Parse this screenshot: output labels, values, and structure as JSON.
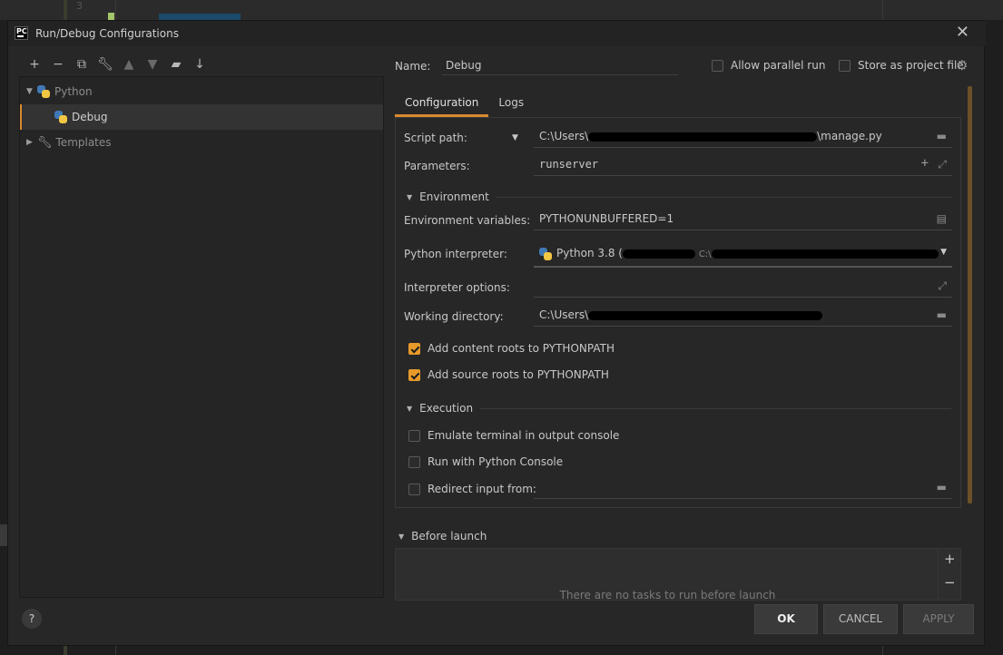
{
  "dialog": {
    "title": "Run/Debug Configurations",
    "app_icon_text": "PC"
  },
  "background": {
    "line_number": "3"
  },
  "toolbar": {
    "icons": [
      "plus-icon",
      "minus-icon",
      "copy-icon",
      "wrench-icon",
      "arrow-up-icon",
      "arrow-down-icon",
      "new-folder-icon",
      "sort-icon"
    ]
  },
  "tree": {
    "python_label": "Python",
    "debug_label": "Debug",
    "templates_label": "Templates"
  },
  "name": {
    "label": "Name:",
    "value": "Debug",
    "allow_parallel": "Allow parallel run",
    "store_project": "Store as project file"
  },
  "tabs": [
    "Configuration",
    "Logs"
  ],
  "config": {
    "script_path_label": "Script path:",
    "script_path_prefix": "C:\\Users\\",
    "script_path_suffix": "\\manage.py",
    "parameters_label": "Parameters:",
    "parameters_value": "runserver",
    "environment_section": "Environment",
    "env_vars_label": "Environment variables:",
    "env_vars_value": "PYTHONUNBUFFERED=1",
    "interpreter_label": "Python interpreter:",
    "interpreter_value": "Python 3.8 (",
    "interpreter_path_prefix": "C:\\",
    "interpreter_options_label": "Interpreter options:",
    "working_dir_label": "Working directory:",
    "working_dir_prefix": "C:\\Users\\",
    "add_content_roots": "Add content roots to PYTHONPATH",
    "add_source_roots": "Add source roots to PYTHONPATH",
    "execution_section": "Execution",
    "emulate_terminal": "Emulate terminal in output console",
    "run_python_console": "Run with Python Console",
    "redirect_input": "Redirect input from:"
  },
  "before_launch": {
    "label": "Before launch",
    "empty_text": "There are no tasks to run before launch"
  },
  "buttons": {
    "help": "?",
    "ok": "OK",
    "cancel": "CANCEL",
    "apply": "APPLY"
  },
  "colors": {
    "accent": "#d8892f",
    "checkbox_on": "#e79a2a",
    "python_blue": "#3f79b6",
    "python_yellow": "#f2c744"
  }
}
